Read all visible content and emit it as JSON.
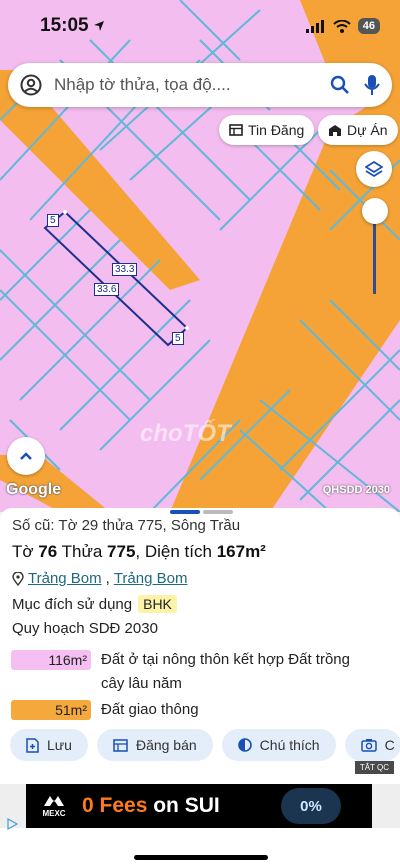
{
  "status_bar": {
    "time": "15:05",
    "battery": "46"
  },
  "search": {
    "placeholder": "Nhập tờ thửa, tọa độ...."
  },
  "map_buttons": {
    "listings": "Tin Đăng",
    "projects": "Dự Án"
  },
  "map_labels": {
    "edge_top_left": "5",
    "edge_top_right": "33.3",
    "edge_bottom_left": "33.6",
    "edge_bottom_right": "5",
    "google": "Google",
    "layer": "QHSDD 2030",
    "watermark": "choTỐT"
  },
  "parcel": {
    "old_info": "Số cũ: Tờ 29 thửa 775, Sông Trầu",
    "sheet_label": "Tờ",
    "sheet_no": "76",
    "plot_label": "Thửa",
    "plot_no": "775",
    "area_label": ", Diện tích",
    "area": "167m²",
    "district": "Trảng Bom",
    "ward": "Trảng Bom",
    "purpose_label": "Mục đích sử dụng",
    "purpose_code": "BHK",
    "plan_label": "Quy hoạch SDĐ 2030"
  },
  "legend": [
    {
      "area": "116m²",
      "text_line1": "Đất ở tại nông thôn kết hợp Đất trồng",
      "text_line2": "cây lâu năm",
      "color": "#f6bff2"
    },
    {
      "area": "51m²",
      "text_line1": "Đất giao thông",
      "text_line2": "",
      "color": "#f5a83c"
    }
  ],
  "actions": {
    "save": "Lưu",
    "sell": "Đăng bán",
    "note": "Chú thích",
    "more": "C"
  },
  "ad": {
    "label": "TẮT QC",
    "brand": "MEXC",
    "headline_hl": "0 Fees",
    "headline_rest": " on SUI",
    "coin": "0%"
  },
  "colors": {
    "zone_pink": "#f3bdf0",
    "road_orange": "#f5a336",
    "lot_line": "#5fb8d8",
    "parcel_outline": "#1e2f8c"
  }
}
